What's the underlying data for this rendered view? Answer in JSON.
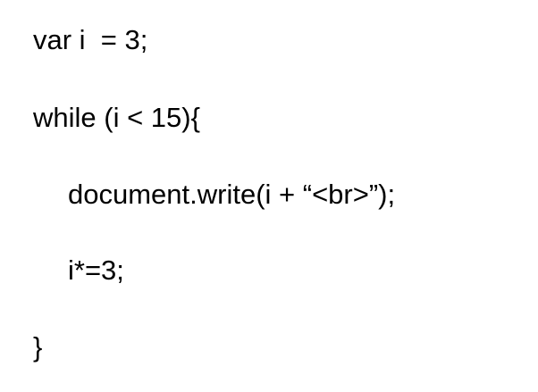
{
  "code": {
    "lines": [
      "var i  = 3;",
      "while (i < 15){",
      "document.write(i + “<br>”);",
      "i*=3;",
      "}"
    ]
  },
  "colors": {
    "background": "#ffffff",
    "text": "#000000"
  }
}
